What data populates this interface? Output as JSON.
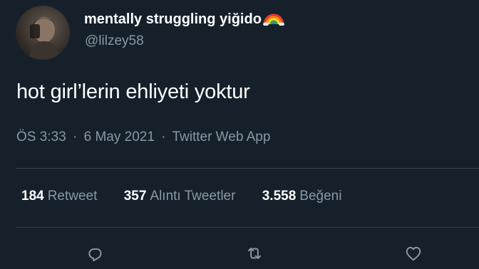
{
  "author": {
    "display_name": "mentally struggling yiğido",
    "handle": "@lilzey58",
    "avatar_icon": "profile-photo",
    "name_emoji_icon": "rainbow-icon"
  },
  "tweet": {
    "text": "hot girl’lerin ehliyeti yoktur",
    "time": "ÖS 3:33",
    "date": "6 May 2021",
    "source": "Twitter Web App",
    "separator": "·"
  },
  "stats": {
    "retweets_count": "184",
    "retweets_label": "Retweet",
    "quotes_count": "357",
    "quotes_label": "Alıntı Tweetler",
    "likes_count": "3.558",
    "likes_label": "Beğeni"
  },
  "actions": {
    "reply_icon": "reply-icon",
    "retweet_icon": "retweet-icon",
    "like_icon": "heart-icon"
  },
  "colors": {
    "background": "#15202b",
    "text_primary": "#ffffff",
    "text_secondary": "#8899a6",
    "divider": "#38444d"
  }
}
